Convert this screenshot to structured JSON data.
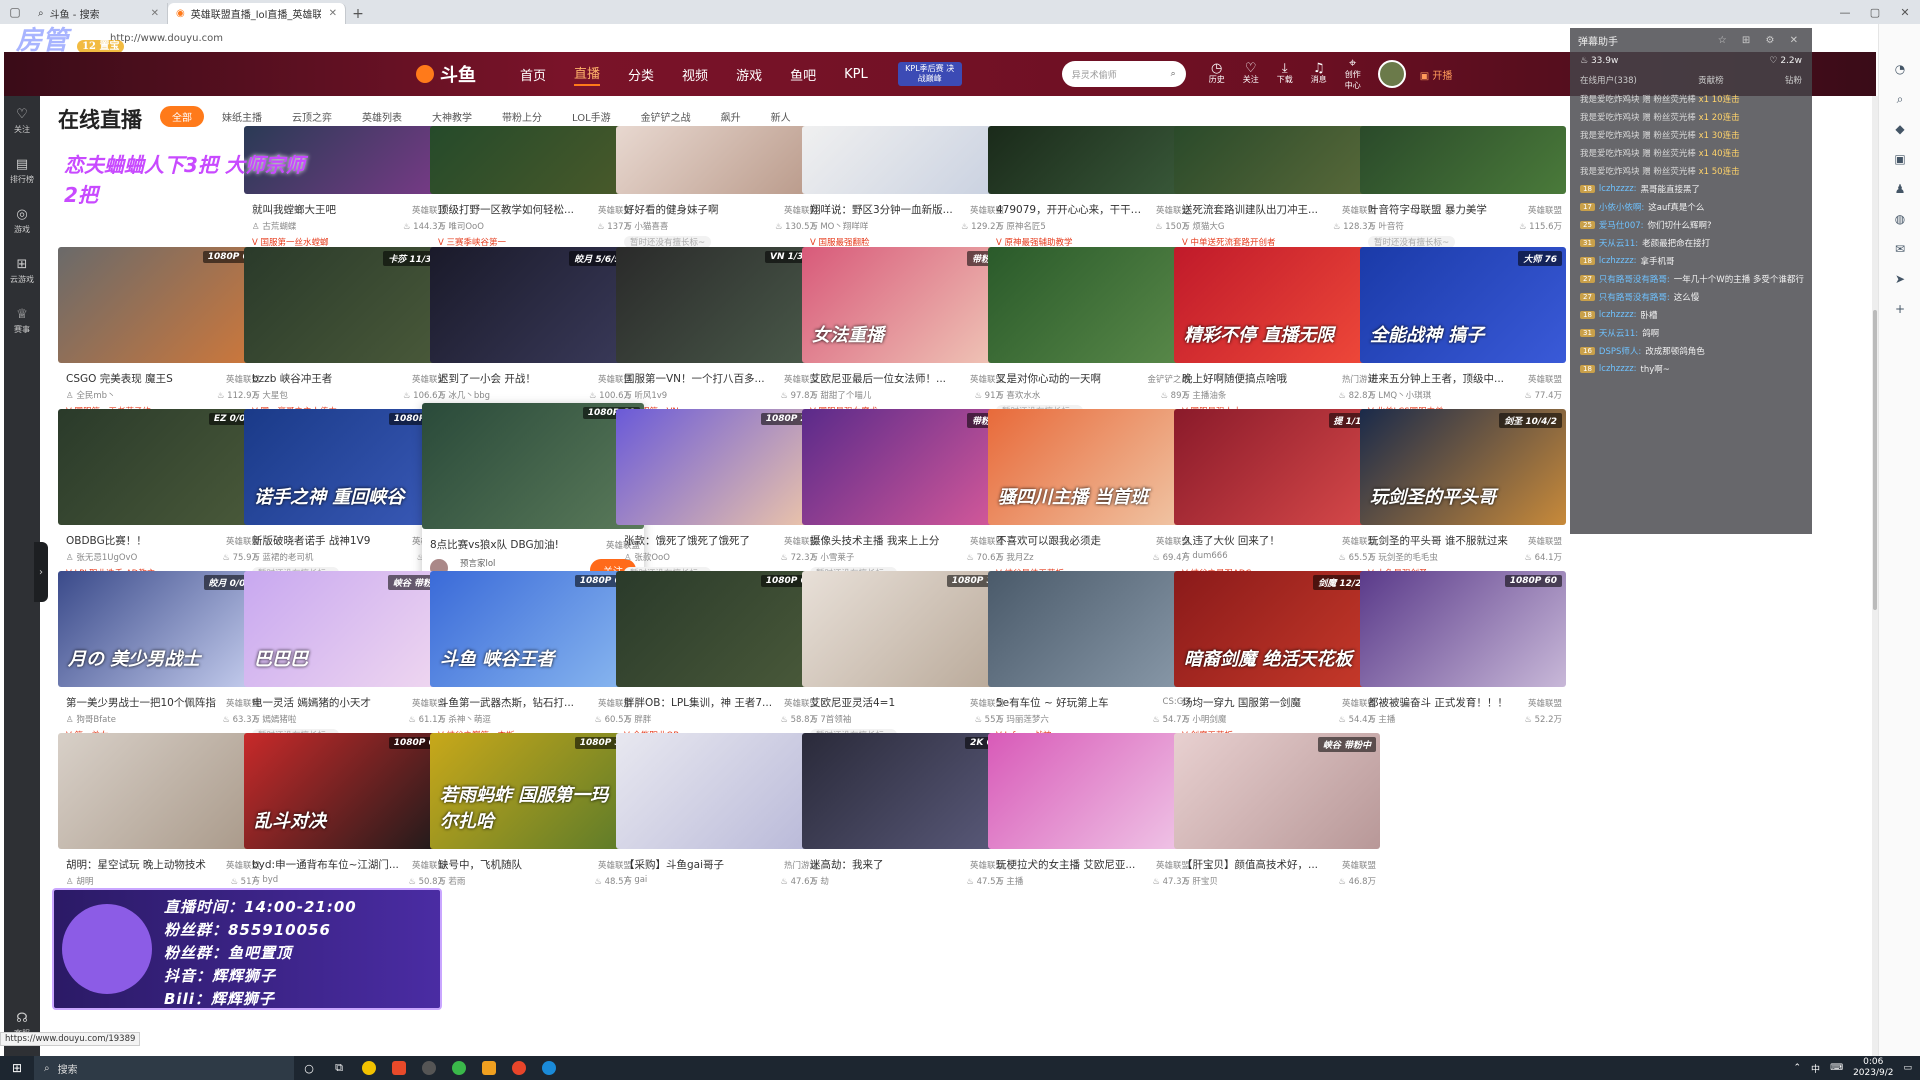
{
  "browser": {
    "tabs": [
      {
        "label": "斗鱼 - 搜索"
      },
      {
        "label": "英雄联盟直播_lol直播_英雄联盟视频..."
      }
    ],
    "url": "http://www.douyu.com",
    "overlay_logo": "房管",
    "overlay_badge": "12 置宝"
  },
  "topnav": {
    "logo": "斗鱼",
    "links": [
      "首页",
      "直播",
      "分类",
      "视频",
      "游戏",
      "鱼吧",
      "KPL"
    ],
    "active": "直播",
    "kpl_badge": "KPL季后赛 决战巅峰",
    "search_placeholder": "异灵术偷师",
    "icons": [
      {
        "icon": "history-icon",
        "label": "历史"
      },
      {
        "icon": "heart-icon",
        "label": "关注"
      },
      {
        "icon": "download-icon",
        "label": "下载"
      },
      {
        "icon": "bell-icon",
        "label": "消息"
      },
      {
        "icon": "pin-icon",
        "label": "创作中心"
      }
    ],
    "avatar_badge": "13",
    "live_label": "开播"
  },
  "leftbar": {
    "items": [
      {
        "icon": "heart-icon",
        "label": "关注"
      },
      {
        "icon": "rank-icon",
        "label": "排行榜"
      },
      {
        "icon": "game-icon",
        "label": "游戏"
      },
      {
        "icon": "gamepad-icon",
        "label": "云游戏"
      },
      {
        "icon": "trophy-icon",
        "label": "赛事"
      }
    ],
    "bottom": {
      "icon": "headset-icon",
      "label": "客服"
    }
  },
  "page": {
    "heading": "在线直播",
    "overlay_text": "恋夫蛐蛐人下3把 大师宗师2把",
    "filters": [
      "全部",
      "妹纸主播",
      "云顶之弈",
      "英雄列表",
      "大神教学",
      "带粉上分",
      "LOL手游",
      "金铲铲之战",
      "飙升",
      "新人"
    ],
    "active_filter": "全部"
  },
  "cards": [
    {
      "title": "就叫我螳螂大王吧",
      "cat": "英雄联盟",
      "streamer": "古荒蝴蝶",
      "views": "144.3万",
      "tag": "国服第一丝水螳螂",
      "grey": false,
      "badge": "",
      "art": "",
      "c1": "#2a3a55",
      "c2": "#7a3a88"
    },
    {
      "title": "顶级打野一区教学如何轻松...",
      "cat": "英雄联盟",
      "streamer": "唯司OoO",
      "views": "137万",
      "tag": "三赛季峡谷第一",
      "grey": false,
      "badge": "",
      "art": "",
      "c1": "#254a2a",
      "c2": "#4a5a2a"
    },
    {
      "title": "好好看的健身妹子啊",
      "cat": "英雄联盟",
      "streamer": "小猫喜喜",
      "views": "130.5万",
      "tag": "暂时还没有擅长标~",
      "grey": true,
      "badge": "",
      "art": "",
      "c1": "#e8d8d0",
      "c2": "#b89888"
    },
    {
      "title": "翔咩说：野区3分钟一血新版...",
      "cat": "英雄联盟",
      "streamer": "MO丶翔咩咩",
      "views": "129.2万",
      "tag": "国服最强翻脸",
      "grey": false,
      "badge": "",
      "art": "",
      "c1": "#f0f0f0",
      "c2": "#c8d0e0"
    },
    {
      "title": "479079，开开心心来，干干净净...",
      "cat": "英雄联盟",
      "streamer": "原神名匠5",
      "views": "150万",
      "tag": "原神最强辅助教学",
      "grey": false,
      "badge": "",
      "art": "",
      "c1": "#1a2a1a",
      "c2": "#3a5a3a"
    },
    {
      "title": "送死流套路训建队出刀冲王...",
      "cat": "英雄联盟",
      "streamer": "烦猫大G",
      "views": "128.3万",
      "tag": "中单送死流套路开创者",
      "grey": false,
      "badge": "",
      "art": "",
      "c1": "#2a4a2a",
      "c2": "#5a6a3a"
    },
    {
      "title": "叶音符字母联盟 暴力美学",
      "cat": "英雄联盟",
      "streamer": "叶音符",
      "views": "115.6万",
      "tag": "暂时还没有擅长标~",
      "grey": true,
      "badge": "",
      "art": "",
      "c1": "#2a4a2a",
      "c2": "#4a7a3a"
    },
    {
      "title": "CSGO 完美表现 魔王S",
      "cat": "英雄联盟",
      "streamer": "全民mb丶",
      "views": "112.9万",
      "tag": "国服第一王者萨子约",
      "grey": false,
      "badge": "1080P 60",
      "art": "",
      "c1": "#6a6a6a",
      "c2": "#d0783a"
    },
    {
      "title": "bzzb 峡谷冲王者",
      "cat": "英雄联盟",
      "streamer": "大星包",
      "views": "106.6万",
      "tag": "国一豪哥之主人传力",
      "grey": false,
      "badge": "卡莎 11/3/3",
      "art": "",
      "c1": "#2a3a2a",
      "c2": "#4a5a3a"
    },
    {
      "title": "迟到了一小会 开战！",
      "cat": "英雄联盟",
      "streamer": "冰几丶bbg",
      "views": "100.6万",
      "tag": "暂时还没有擅长标~",
      "grey": true,
      "badge": "皎月 5/6/51",
      "art": "",
      "c1": "#1a1a2a",
      "c2": "#3a3a5a"
    },
    {
      "title": "国服第一VN！一个打八百多...",
      "cat": "英雄联盟",
      "streamer": "听风1v9",
      "views": "97.8万",
      "tag": "国服第一VN",
      "grey": false,
      "badge": "VN 1/3/1",
      "art": "",
      "c1": "#2a2a2a",
      "c2": "#4a5a4a"
    },
    {
      "title": "艾欧尼亚最后一位女法师！...",
      "cat": "英雄联盟",
      "streamer": "甜甜了个喵儿",
      "views": "91万",
      "tag": "国服最强女魔术",
      "grey": false,
      "badge": "带粉中",
      "art": "女法重播",
      "c1": "#d85a7a",
      "c2": "#f0c8b8"
    },
    {
      "title": "又是对你心动的一天啊",
      "cat": "金铲铲之战",
      "streamer": "喜欢水水",
      "views": "89万",
      "tag": "暂时还没有擅长标~",
      "grey": true,
      "badge": "",
      "art": "",
      "c1": "#2a5a2a",
      "c2": "#5a8a4a"
    },
    {
      "title": "晚上好啊随便搞点啥哦",
      "cat": "热门游戏",
      "streamer": "主播油条",
      "views": "82.8万",
      "tag": "国服最强人士",
      "grey": false,
      "badge": "",
      "art": "精彩不停 直播无限",
      "c1": "#c01a2a",
      "c2": "#f04a3a"
    },
    {
      "title": "进来五分钟上王者，顶级中...",
      "cat": "英雄联盟",
      "streamer": "LMQ丶小琪琪",
      "views": "77.4万",
      "tag": "北美LCS国服中单",
      "grey": false,
      "badge": "大师 76",
      "art": "全能战神 搞子",
      "c1": "#1a3aa8",
      "c2": "#3a5ad8"
    },
    {
      "title": "OBDBG比赛！！",
      "cat": "英雄联盟",
      "streamer": "张无忌1UgOvO",
      "views": "75.9万",
      "tag": "LPL职业选手 AD教主",
      "grey": false,
      "badge": "EZ 0/0/0",
      "art": "",
      "c1": "#2a3a2a",
      "c2": "#4a5a3a"
    },
    {
      "title": "新版破晓者诺手 战神1V9",
      "cat": "英雄联盟",
      "streamer": "蓝裙的老司机",
      "views": "75万",
      "tag": "暂时还没有擅长标~",
      "grey": true,
      "badge": "1080P 60",
      "art": "诺手之神 重回峡谷",
      "c1": "#1a3a88",
      "c2": "#3a5ab8"
    },
    {
      "title": "8点比赛vs狼x队 DBG加油!",
      "cat": "英雄联盟",
      "streamer": "预言家lol",
      "views": "74.9万",
      "tag": "LPL职业选手",
      "grey": false,
      "badge": "1080P 60",
      "art": "",
      "c1": "#2a4a3a",
      "c2": "#5a7a5a",
      "hover": true
    },
    {
      "title": "张款：饿死了饿死了饿死了",
      "cat": "英雄联盟",
      "streamer": "张款OoO",
      "views": "72.3万",
      "tag": "暂时还没有擅长标~",
      "grey": true,
      "badge": "1080P 20",
      "art": "",
      "c1": "#6a5ad8",
      "c2": "#f0c8a8"
    },
    {
      "title": "摄像头技术主播 我来上上分",
      "cat": "英雄联盟",
      "streamer": "小雪莱子",
      "views": "70.6万",
      "tag": "暂时还没有擅长标~",
      "grey": true,
      "badge": "带粉中",
      "art": "",
      "c1": "#5a2a8a",
      "c2": "#d85a9a"
    },
    {
      "title": "不喜欢可以跟我必须走",
      "cat": "英雄联盟",
      "streamer": "我月Zz",
      "views": "69.4万",
      "tag": "峡谷最佳天花板",
      "grey": false,
      "badge": "",
      "art": "骚四川主播 当首班",
      "c1": "#e86a3a",
      "c2": "#f0c8a8"
    },
    {
      "title": "久违了大伙 回来了！",
      "cat": "英雄联盟",
      "streamer": "dum666",
      "views": "65.5万",
      "tag": "峡谷之最强ADC",
      "grey": false,
      "badge": "提 1/1/1",
      "art": "",
      "c1": "#8a1a2a",
      "c2": "#d84a4a"
    },
    {
      "title": "玩剑圣的平头哥 谁不服就过来",
      "cat": "英雄联盟",
      "streamer": "玩剑圣的毛毛虫",
      "views": "64.1万",
      "tag": "小鱼最强剑圣",
      "grey": false,
      "badge": "剑圣 10/4/2",
      "art": "玩剑圣的平头哥",
      "c1": "#1a2a4a",
      "c2": "#c88a3a"
    },
    {
      "title": "第一美少男战士一把10个佩阵指",
      "cat": "英雄联盟",
      "streamer": "狗哥Bfate",
      "views": "63.3万",
      "tag": "第一美女",
      "grey": false,
      "badge": "皎月 0/0/0",
      "art": "月の 美少男战士",
      "c1": "#3a4a8a",
      "c2": "#c8d0f0"
    },
    {
      "title": "电一灵活 嫣嫣猪的小天才",
      "cat": "英雄联盟",
      "streamer": "嫣嫣猪啦",
      "views": "61.1万",
      "tag": "暂时还没有擅长标~",
      "grey": true,
      "badge": "峡谷 带粉中",
      "art": "巴巴巴",
      "c1": "#c8a8f0",
      "c2": "#f0d8f0"
    },
    {
      "title": "斗鱼第一武器杰斯，钻石打...",
      "cat": "英雄联盟",
      "streamer": "杀神丶萌逗",
      "views": "60.5万",
      "tag": "峡谷之巅第一杰斯",
      "grey": false,
      "badge": "1080P 60",
      "art": "斗鱼 峡谷王者",
      "c1": "#3a6ad8",
      "c2": "#8ab8f0"
    },
    {
      "title": "胖胖OB：LPL集训，神 王者7...",
      "cat": "英雄联盟",
      "streamer": "胖胖",
      "views": "58.8万",
      "tag": "全能职业OB",
      "grey": false,
      "badge": "1080P 60",
      "art": "",
      "c1": "#2a3a2a",
      "c2": "#4a5a3a"
    },
    {
      "title": "艾欧尼亚灵活4=1",
      "cat": "英雄联盟",
      "streamer": "7首领袖",
      "views": "55万",
      "tag": "暂时还没有擅长标~",
      "grey": true,
      "badge": "1080P 30",
      "art": "",
      "c1": "#e8e0d8",
      "c2": "#b8a898"
    },
    {
      "title": "5e有车位 ~ 好玩第上车",
      "cat": "CS:GO",
      "streamer": "玛丽莲梦六",
      "views": "54.7万",
      "tag": "Inferno战神",
      "grey": false,
      "badge": "",
      "art": "",
      "c1": "#4a5a6a",
      "c2": "#8a9aaa"
    },
    {
      "title": "场均一穿九 国服第一剑魔",
      "cat": "英雄联盟",
      "streamer": "小明剑魔",
      "views": "54.4万",
      "tag": "剑魔天花板",
      "grey": false,
      "badge": "剑魔 12/2/3",
      "art": "暗裔剑魔 绝活天花板",
      "c1": "#8a1a1a",
      "c2": "#c83a2a"
    },
    {
      "title": "都被被骗奋斗 正式发育！！！",
      "cat": "英雄联盟",
      "streamer": "主播",
      "views": "52.2万",
      "tag": "",
      "grey": false,
      "badge": "1080P 60",
      "art": "",
      "c1": "#5a3a8a",
      "c2": "#c8b8d8"
    },
    {
      "title": "胡明：星空试玩 晚上动物技术",
      "cat": "英雄联盟",
      "streamer": "胡明",
      "views": "51万",
      "tag": "",
      "grey": false,
      "badge": "",
      "art": "",
      "c1": "#d8d0c8",
      "c2": "#a89888"
    },
    {
      "title": "byd:申一通背布车位~江湖门...",
      "cat": "英雄联盟",
      "streamer": "byd",
      "views": "50.8万",
      "tag": "",
      "grey": false,
      "badge": "1080P 60",
      "art": "乱斗对决",
      "c1": "#c82a2a",
      "c2": "#1a1a1a"
    },
    {
      "title": "缺号中，飞机随队",
      "cat": "英雄联盟",
      "streamer": "若雨",
      "views": "48.5万",
      "tag": "",
      "grey": false,
      "badge": "1080P 30",
      "art": "若雨蚂蚱 国服第一玛尔扎哈",
      "c1": "#c8a81a",
      "c2": "#5a7a2a"
    },
    {
      "title": "【采购】斗鱼gai哥子",
      "cat": "热门游戏",
      "streamer": "gai",
      "views": "47.6万",
      "tag": "",
      "grey": false,
      "badge": "",
      "art": "",
      "c1": "#e8e8f0",
      "c2": "#b8b8d8"
    },
    {
      "title": "迷高劫：我来了",
      "cat": "英雄联盟",
      "streamer": "劫",
      "views": "47.5万",
      "tag": "",
      "grey": false,
      "badge": "2K 60",
      "art": "",
      "c1": "#2a2a3a",
      "c2": "#5a5a7a"
    },
    {
      "title": "玩梗拉犬的女主播 艾欧尼亚...",
      "cat": "英雄联盟",
      "streamer": "主播",
      "views": "47.3万",
      "tag": "",
      "grey": false,
      "badge": "",
      "art": "",
      "c1": "#d85ab8",
      "c2": "#f0c8e8"
    },
    {
      "title": "【肝宝贝】颜值高技术好，...",
      "cat": "英雄联盟",
      "streamer": "肝宝贝",
      "views": "46.8万",
      "tag": "",
      "grey": false,
      "badge": "峡谷 带粉中",
      "art": "",
      "c1": "#e8d0d0",
      "c2": "#b89898"
    }
  ],
  "promo": {
    "lines": [
      "直播时间：14:00-21:00",
      "粉丝群：855910056",
      "粉丝群：鱼吧置顶",
      "抖音：辉辉狮子",
      "Bili：辉辉狮子"
    ]
  },
  "status_url": "https://www.douyu.com/19389",
  "chat": {
    "title": "弹幕助手",
    "count_left": "33.9w",
    "count_right": "2.2w",
    "tabs": [
      "在线用户(338)",
      "贡献榜",
      "钻粉"
    ],
    "gifts": [
      {
        "user": "我是爱吃炸鸡块",
        "text": "赠 粉丝荧光棒",
        "amt": "x1 10连击"
      },
      {
        "user": "我是爱吃炸鸡块",
        "text": "赠 粉丝荧光棒",
        "amt": "x1 20连击"
      },
      {
        "user": "我是爱吃炸鸡块",
        "text": "赠 粉丝荧光棒",
        "amt": "x1 30连击"
      },
      {
        "user": "我是爱吃炸鸡块",
        "text": "赠 粉丝荧光棒",
        "amt": "x1 40连击"
      },
      {
        "user": "我是爱吃炸鸡块",
        "text": "赠 粉丝荧光棒",
        "amt": "x1 50连击"
      }
    ],
    "messages": [
      {
        "lvl": "18",
        "name": "lczhzzzz:",
        "text": "黑哥能直接黑了"
      },
      {
        "lvl": "17",
        "name": "小依小依啊:",
        "text": "这auf真是个么"
      },
      {
        "lvl": "25",
        "name": "爱马仕007:",
        "text": "你们切什么辉啊?"
      },
      {
        "lvl": "31",
        "name": "天从云11:",
        "text": "老颜最把命在接打"
      },
      {
        "lvl": "18",
        "name": "lczhzzzz:",
        "text": "拿手机哥"
      },
      {
        "lvl": "27",
        "name": "只有路哥没有路哥:",
        "text": "一年几十个W的主播 多受个谁都行"
      },
      {
        "lvl": "27",
        "name": "只有路哥没有路哥:",
        "text": "这么慢"
      },
      {
        "lvl": "18",
        "name": "lczhzzzz:",
        "text": "卧槽"
      },
      {
        "lvl": "31",
        "name": "天从云11:",
        "text": "鸽啊"
      },
      {
        "lvl": "16",
        "name": "DSPS师人:",
        "text": "改成那顿鸽角色"
      },
      {
        "lvl": "18",
        "name": "lczhzzzz:",
        "text": "thy啊~"
      }
    ]
  },
  "taskbar": {
    "search": "搜索",
    "ime": "中",
    "time": "0:06",
    "date": "2023/9/2"
  }
}
